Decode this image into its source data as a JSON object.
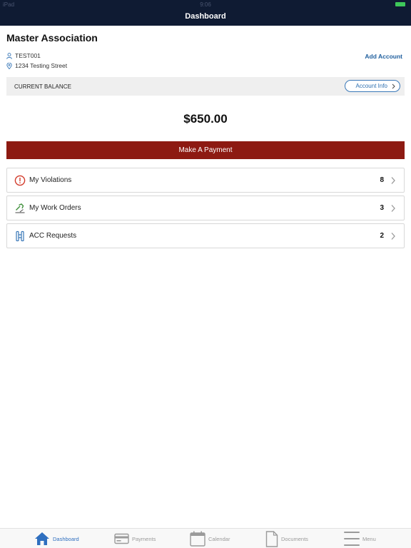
{
  "status_bar": {
    "carrier": "iPad",
    "time": "9:06"
  },
  "nav": {
    "title": "Dashboard"
  },
  "association": {
    "name": "Master Association",
    "account_id": "TEST001",
    "address": "1234 Testing Street",
    "add_account_label": "Add Account"
  },
  "balance": {
    "label": "CURRENT BALANCE",
    "account_info_label": "Account Info",
    "amount": "$650.00"
  },
  "payment_button": {
    "label": "Make A Payment"
  },
  "items": [
    {
      "label": "My Violations",
      "count": "8",
      "icon": "alert-circle-icon"
    },
    {
      "label": "My Work Orders",
      "count": "3",
      "icon": "hammer-icon"
    },
    {
      "label": "ACC Requests",
      "count": "2",
      "icon": "acc-request-icon"
    }
  ],
  "tabs": [
    {
      "label": "Dashboard",
      "icon": "home-icon",
      "active": true
    },
    {
      "label": "Payments",
      "icon": "credit-card-icon",
      "active": false
    },
    {
      "label": "Calendar",
      "icon": "calendar-icon",
      "active": false
    },
    {
      "label": "Documents",
      "icon": "document-icon",
      "active": false
    },
    {
      "label": "Menu",
      "icon": "menu-icon",
      "active": false
    }
  ],
  "colors": {
    "nav_bg": "#0f1b33",
    "accent_blue": "#2f6fbf",
    "pay_button": "#8d1a12",
    "violation_red": "#d23a2a",
    "work_order_green": "#3f8f3a"
  }
}
